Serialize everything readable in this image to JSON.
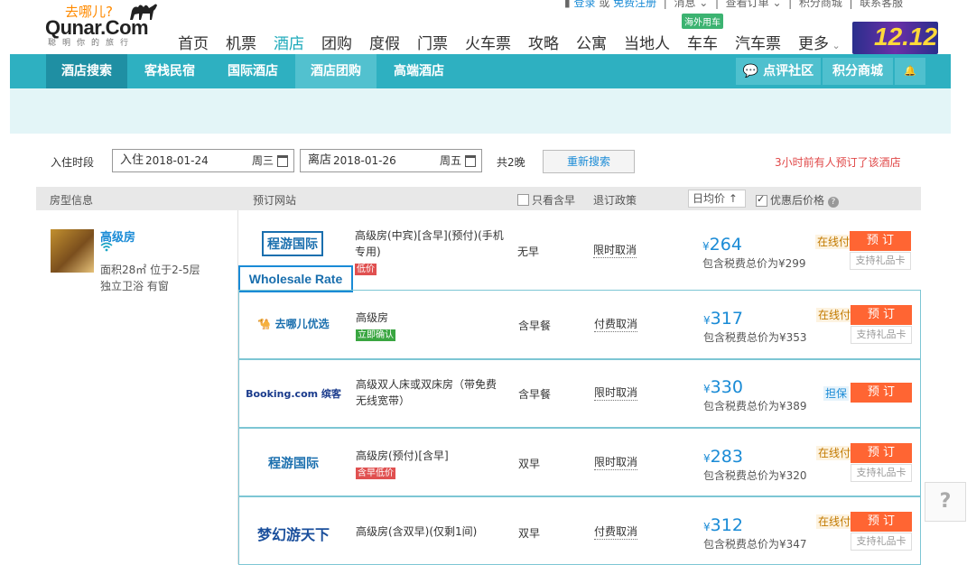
{
  "header": {
    "logo_cn": "去哪儿?",
    "logo_en": "Qunar.Com",
    "logo_slogan": "聪明你的旅行",
    "top_links": [
      {
        "label": "登录",
        "link": true
      },
      {
        "label": "或",
        "link": false
      },
      {
        "label": "免费注册",
        "link": true
      },
      {
        "label": "消息 ⌄",
        "link": false
      },
      {
        "label": "查看订单 ⌄",
        "link": false
      },
      {
        "label": "积分商城",
        "link": false
      },
      {
        "label": "联系客服",
        "link": false
      }
    ],
    "nav": [
      "首页",
      "机票",
      "酒店",
      "团购",
      "度假",
      "门票",
      "火车票",
      "攻略",
      "公寓",
      "当地人",
      "车车",
      "汽车票",
      "更多"
    ],
    "nav_active": "酒店",
    "nav_badge": "海外用车",
    "promo_text": "12.12"
  },
  "subnav": {
    "tabs": [
      "酒店搜索",
      "客栈民宿",
      "国际酒店",
      "酒店团购",
      "高端酒店"
    ],
    "active": "酒店搜索",
    "right": [
      "💬 点评社区",
      "积分商城",
      "🔔"
    ]
  },
  "search": {
    "period_label": "入住时段",
    "checkin": {
      "key": "入住",
      "date": "2018-01-24",
      "weekday": "周三"
    },
    "checkout": {
      "key": "离店",
      "date": "2018-01-26",
      "weekday": "周五"
    },
    "nights": "共2晚",
    "research_button": "重新搜索",
    "notice": "3小时前有人预订了该酒店"
  },
  "table_header": {
    "room_info": "房型信息",
    "site": "预订网站",
    "breakfast_filter": "只看含早",
    "cancel_policy": "退订政策",
    "sort": "日均价 ↑",
    "discount": "优惠后价格"
  },
  "room": {
    "name": "高级房",
    "wifi_icon": "wifi",
    "desc_line1": "面积28㎡  位于2-5层",
    "desc_line2": "独立卫浴  有窗"
  },
  "offers": [
    {
      "logo": "程游国际",
      "title": "高级房(中宾)[含早](预付)(手机专用)",
      "tag": "低价",
      "tag_color": "red",
      "meal": "无早",
      "cancel": "限时取消",
      "price": "264",
      "total": "包含税费总价为¥299",
      "pay": "在线付",
      "book": "预 订",
      "gift": "支持礼品卡",
      "badge": "Wholesale Rate"
    },
    {
      "logo": "去哪儿优选",
      "title": "高级房",
      "tag": "立即确认",
      "tag_color": "green",
      "meal": "含早餐",
      "cancel": "付费取消",
      "price": "317",
      "total": "包含税费总价为¥353",
      "pay": "在线付",
      "book": "预 订",
      "gift": "支持礼品卡"
    },
    {
      "logo": "Booking.com 缤客",
      "title": "高级双人床或双床房（带免费无线宽带）",
      "tag": "",
      "tag_color": "",
      "meal": "含早餐",
      "cancel": "限时取消",
      "price": "330",
      "total": "包含税费总价为¥389",
      "pay": "担保",
      "book": "预 订",
      "gift": ""
    },
    {
      "logo": "程游国际",
      "title": "高级房(预付)[含早]",
      "tag": "含早低价",
      "tag_color": "red",
      "meal": "双早",
      "cancel": "限时取消",
      "price": "283",
      "total": "包含税费总价为¥320",
      "pay": "在线付",
      "book": "预 订",
      "gift": "支持礼品卡"
    },
    {
      "logo": "梦幻游天下",
      "title": "高级房(含双早)(仅剩1间)",
      "tag": "",
      "tag_color": "",
      "meal": "双早",
      "cancel": "付费取消",
      "price": "312",
      "total": "包含税费总价为¥347",
      "pay": "在线付",
      "book": "预 订",
      "gift": "支持礼品卡"
    }
  ],
  "help_button": "?"
}
